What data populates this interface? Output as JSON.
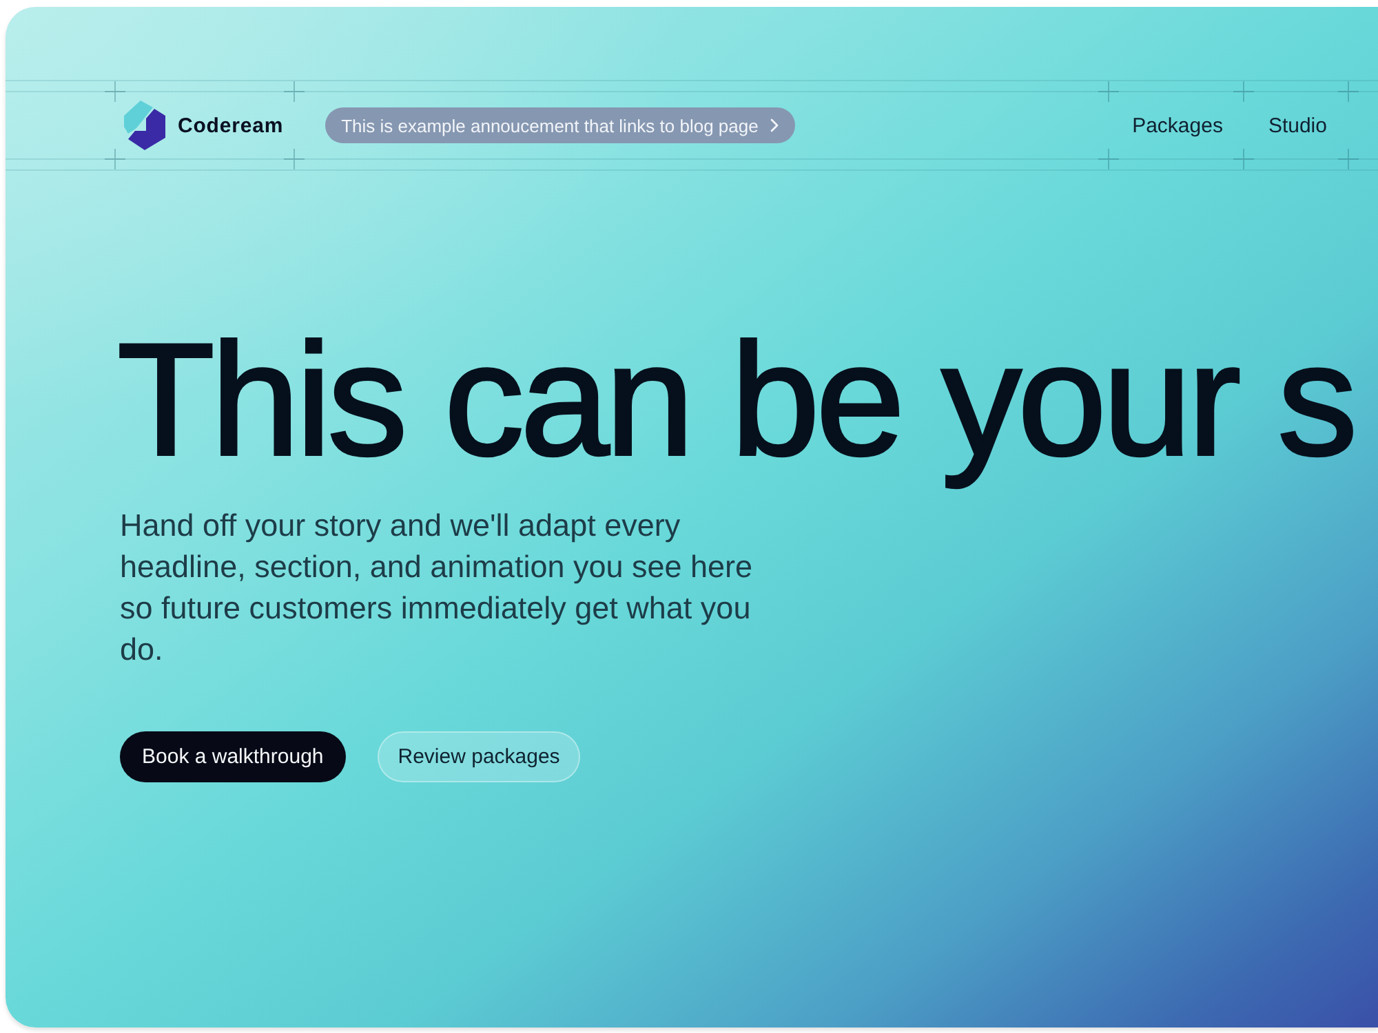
{
  "header": {
    "brand": "Codeream",
    "announcement": "This is example annoucement that links to blog page",
    "nav_links": [
      "Packages",
      "Studio"
    ]
  },
  "hero": {
    "headline": "This can be your s",
    "description": "Hand off your story and we'll adapt every headline, section, and animation you see here so future customers immediately get what you do.",
    "buttons": [
      {
        "label": "Book a walkthrough",
        "kind": "primary"
      },
      {
        "label": "Review packages",
        "kind": "secondary"
      }
    ]
  }
}
